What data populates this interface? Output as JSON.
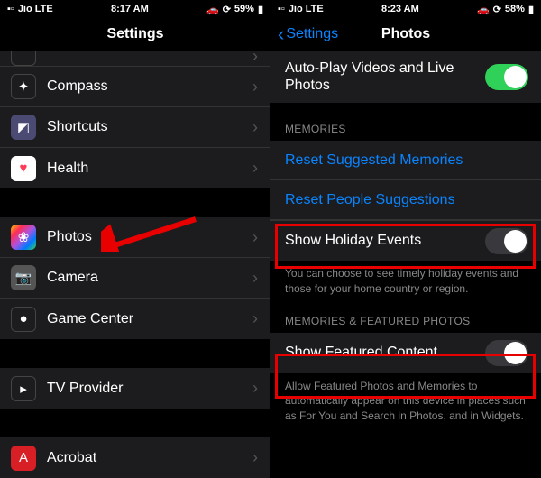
{
  "left": {
    "status": {
      "carrier": "Jio  LTE",
      "time": "8:17 AM",
      "battery": "59%"
    },
    "title": "Settings",
    "rows": [
      {
        "name": "unknown",
        "label": "",
        "icon": "ic-dark",
        "glyph": ""
      },
      {
        "name": "compass",
        "label": "Compass",
        "icon": "ic-dark",
        "glyph": "✦"
      },
      {
        "name": "shortcuts",
        "label": "Shortcuts",
        "icon": "ic-purple",
        "glyph": "◩"
      },
      {
        "name": "health",
        "label": "Health",
        "icon": "ic-white",
        "glyph": "♥"
      }
    ],
    "rows2": [
      {
        "name": "photos",
        "label": "Photos",
        "icon": "ic-photos",
        "glyph": "❀"
      },
      {
        "name": "camera",
        "label": "Camera",
        "icon": "ic-grey",
        "glyph": "📷"
      },
      {
        "name": "game-center",
        "label": "Game Center",
        "icon": "ic-dark",
        "glyph": "●"
      }
    ],
    "rows3": [
      {
        "name": "tv-provider",
        "label": "TV Provider",
        "icon": "ic-dark",
        "glyph": "▸"
      }
    ],
    "rows4": [
      {
        "name": "acrobat",
        "label": "Acrobat",
        "icon": "ic-db",
        "glyph": ""
      }
    ]
  },
  "right": {
    "status": {
      "carrier": "Jio  LTE",
      "time": "8:23 AM",
      "battery": "58%"
    },
    "back": "Settings",
    "title": "Photos",
    "autoplay": "Auto-Play Videos and Live Photos",
    "memories_header": "MEMORIES",
    "reset_memories": "Reset Suggested Memories",
    "reset_people": "Reset People Suggestions",
    "holiday": "Show Holiday Events",
    "holiday_footer": "You can choose to see timely holiday events and those for your home country or region.",
    "featured_header": "MEMORIES & FEATURED PHOTOS",
    "featured": "Show Featured Content",
    "featured_footer": "Allow Featured Photos and Memories to automatically appear on this device in places such as For You and Search in Photos, and in Widgets."
  }
}
